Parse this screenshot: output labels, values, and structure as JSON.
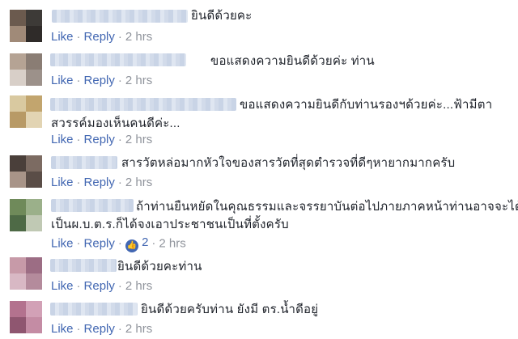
{
  "actions": {
    "like": "Like",
    "reply": "Reply",
    "separator": "·"
  },
  "comments": [
    {
      "text_lines": [
        "ยินดีด้วยคะ"
      ],
      "time": "2 hrs"
    },
    {
      "text_lines": [
        "ขอแสดงความยินดีด้วยค่ะ ท่าน"
      ],
      "time": "2 hrs"
    },
    {
      "text_lines": [
        "ขอแสดงความยินดีกับท่านรองฯด้วยค่ะ...ฟ้ามีตา",
        "สวรรค์มองเห็นคนดีค่ะ..."
      ],
      "time": "2 hrs"
    },
    {
      "text_lines": [
        "สารวัตหล่อมากหัวใจของสารวัตที่สุดตำรวจที่ดีๆหายากมากครับ"
      ],
      "time": "2 hrs"
    },
    {
      "text_lines": [
        "ถ้าท่านยืนหยัดในคุณธรรมและจรรยาบันต่อไปภายภาคหน้าท่านอาจจะได้",
        "เป็นผ.บ.ต.ร.ก็ได้จงเอาประชาชนเป็นที่ตั้งครับ"
      ],
      "time": "2 hrs",
      "reaction_count": "2",
      "reaction_icon": "thumbs-up-icon",
      "accent": "#4267b2"
    },
    {
      "text_lines": [
        "ยินดีด้วยคะท่าน"
      ],
      "time": "2 hrs"
    },
    {
      "text_lines": [
        "ยินดีด้วยครับท่าน ยังมี ตร.น้ำดีอยู่"
      ],
      "time": "2 hrs"
    }
  ],
  "colors": {
    "link": "#4267b2",
    "meta": "#90949c",
    "text": "#1d2129"
  }
}
